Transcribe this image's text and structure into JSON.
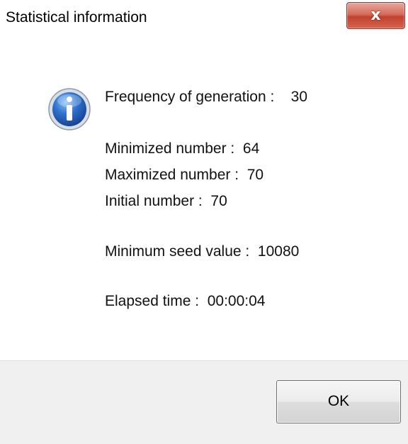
{
  "window": {
    "title": "Statistical information",
    "close_label": "x"
  },
  "message": {
    "icon": "info-icon",
    "frequency": "Frequency of generation :    30",
    "minimized": "Minimized number :  64",
    "maximized": "Maximized number :  70",
    "initial": "Initial number :  70",
    "min_seed": "Minimum seed value :  10080",
    "elapsed": "Elapsed time :  00:00:04"
  },
  "buttons": {
    "ok_label": "OK"
  },
  "colors": {
    "close_button": "#c2412d",
    "footer": "#f0f0f0",
    "icon_blue": "#1e5fbf"
  }
}
